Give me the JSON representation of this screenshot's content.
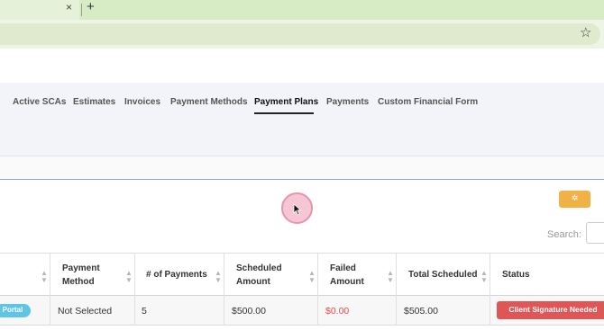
{
  "browser": {
    "tab_close": "×",
    "new_tab": "+",
    "bookmark_star": "☆"
  },
  "app": {
    "clipped_glyph": ")"
  },
  "nav": {
    "tabs": [
      {
        "label": "Active SCAs"
      },
      {
        "label": "Estimates"
      },
      {
        "label": "Invoices"
      },
      {
        "label": "Payment Methods"
      },
      {
        "label": "Payment Plans",
        "active": true
      },
      {
        "label": "Payments"
      },
      {
        "label": "Custom Financial Form"
      }
    ]
  },
  "toolbar": {
    "settings_glyph": "✲"
  },
  "search": {
    "label": "Search:",
    "value": ""
  },
  "table": {
    "headers": [
      "",
      "Payment\nMethod",
      "# of Payments",
      "Scheduled\nAmount",
      "Failed\nAmount",
      "Total Scheduled",
      "Status"
    ],
    "rows": [
      {
        "portal_badge": "Portal",
        "payment_method": "Not Selected",
        "num_payments": "5",
        "scheduled_amount": "$500.00",
        "failed_amount": "$0.00",
        "total_scheduled": "$505.00",
        "status": "Client Signature Needed"
      }
    ]
  },
  "colors": {
    "accent_orange": "#f1b245",
    "status_red": "#e05555",
    "portal_blue": "#5ec5e6",
    "failed_red": "#e34b4b"
  }
}
